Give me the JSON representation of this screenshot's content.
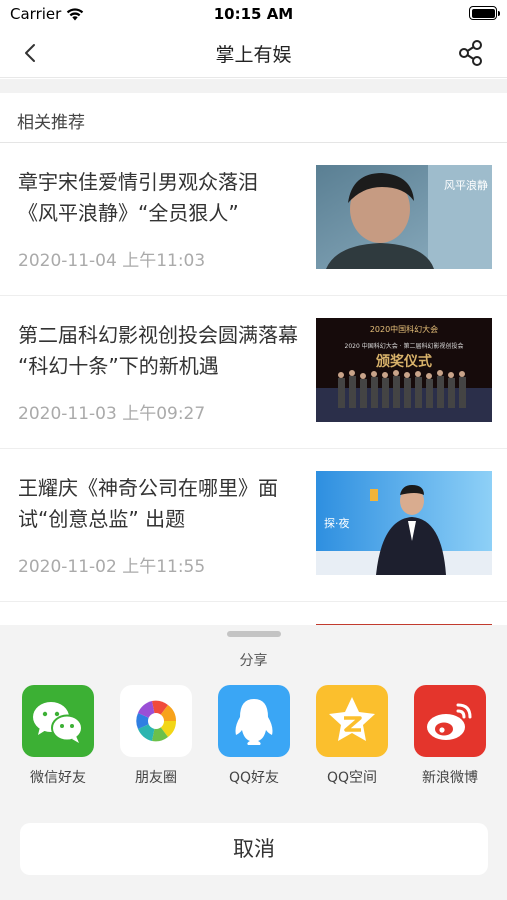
{
  "status_bar": {
    "carrier": "Carrier",
    "time": "10:15 AM",
    "battery_level": 1.0
  },
  "nav": {
    "title": "掌上有娱"
  },
  "section": {
    "title": "相关推荐"
  },
  "articles": [
    {
      "title": "章宇宋佳爱情引男观众落泪 《风平浪静》“全员狠人”",
      "time": "2020-11-04 上午11:03",
      "thumb_text": "风平浪静"
    },
    {
      "title": "第二届科幻影视创投会圆满落幕 “科幻十条”下的新机遇",
      "time": "2020-11-03 上午09:27",
      "thumb_text": "2020中国科幻大会",
      "thumb_sub": "2020 中国科幻大会 · 第二届科幻影视创投会",
      "thumb_banner": "颁奖仪式"
    },
    {
      "title": "王耀庆《神奇公司在哪里》面试“创意总监” 出题",
      "time": "2020-11-02 上午11:55",
      "thumb_text": "探·夜"
    }
  ],
  "share_sheet": {
    "title": "分享",
    "options": [
      {
        "label": "微信好友",
        "icon": "wechat-icon",
        "color": "#3cb034"
      },
      {
        "label": "朋友圈",
        "icon": "moments-icon",
        "color": "#ffffff"
      },
      {
        "label": "QQ好友",
        "icon": "qq-icon",
        "color": "#3aa6f5"
      },
      {
        "label": "QQ空间",
        "icon": "qzone-icon",
        "color": "#fbbf2d"
      },
      {
        "label": "新浪微博",
        "icon": "weibo-icon",
        "color": "#e4352c"
      }
    ],
    "cancel": "取消"
  }
}
